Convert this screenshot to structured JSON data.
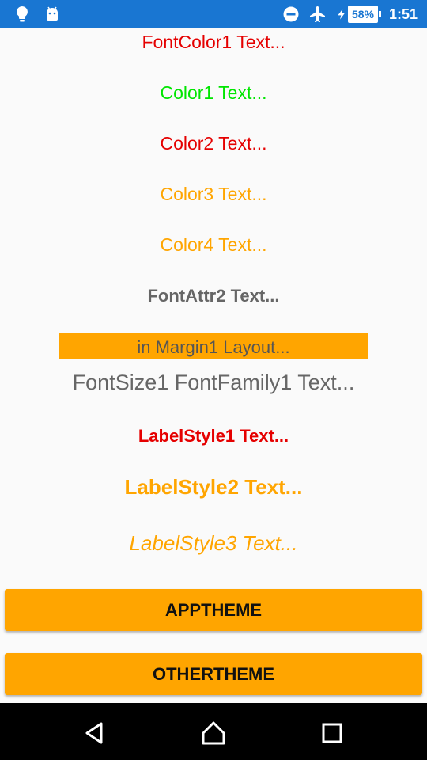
{
  "status_bar": {
    "battery_percent": "58%",
    "time": "1:51",
    "icons": [
      "bulb-icon",
      "android-icon",
      "do-not-disturb-icon",
      "airplane-mode-icon",
      "charging-bolt-icon",
      "battery-icon"
    ]
  },
  "labels": {
    "font_color1": "FontColor1 Text...",
    "color1": "Color1 Text...",
    "color2": "Color2 Text...",
    "color3": "Color3 Text...",
    "color4": "Color4 Text...",
    "font_attr2": "FontAttr2 Text...",
    "margin1": "in Margin1 Layout...",
    "font_size1": "FontSize1 FontFamily1 Text...",
    "label_style1": "LabelStyle1 Text...",
    "label_style2": "LabelStyle2 Text...",
    "label_style3": "LabelStyle3 Text..."
  },
  "buttons": {
    "app_theme": "APPTHEME",
    "other_theme": "OTHERTHEME"
  },
  "colors": {
    "status_bar": "#1976d2",
    "red": "#e50000",
    "green": "#00e600",
    "orange": "#ffa500",
    "gray": "#666666"
  },
  "nav_bar": {
    "icons": [
      "back-icon",
      "home-icon",
      "recent-apps-icon"
    ]
  }
}
